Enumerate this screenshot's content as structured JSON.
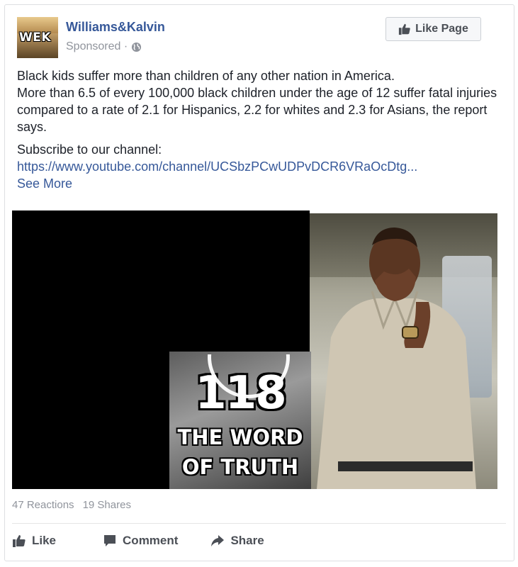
{
  "post": {
    "page_name": "Williams&Kalvin",
    "avatar_text": "WEK",
    "sponsored": "Sponsored ·",
    "like_page_label": "Like Page",
    "text_line1": "Black kids suffer more than children of any other nation in America.",
    "text_line2": "More than 6.5 of every 100,000 black children under the age of 12 suffer fatal injuries compared to a rate of 2.1 for Hispanics, 2.2 for whites and 2.3 for Asians, the report says.",
    "subscribe_label": "Subscribe to our channel:",
    "link": "https://www.youtube.com/channel/UCSbzPCwUDPvDCR6VRaOcDtg...",
    "see_more": "See More"
  },
  "video": {
    "thumb_number": "118",
    "thumb_title_line1": "THE WORD",
    "thumb_title_line2": "OF TRUTH"
  },
  "stats": {
    "reactions": "47 Reactions",
    "shares": "19 Shares"
  },
  "actions": {
    "like": "Like",
    "comment": "Comment",
    "share": "Share"
  },
  "colors": {
    "link": "#365899",
    "muted": "#90949c",
    "action": "#4b4f56"
  },
  "icons": [
    "globe-icon",
    "thumbs-up-icon",
    "comment-icon",
    "share-arrow-icon",
    "play-icon"
  ]
}
